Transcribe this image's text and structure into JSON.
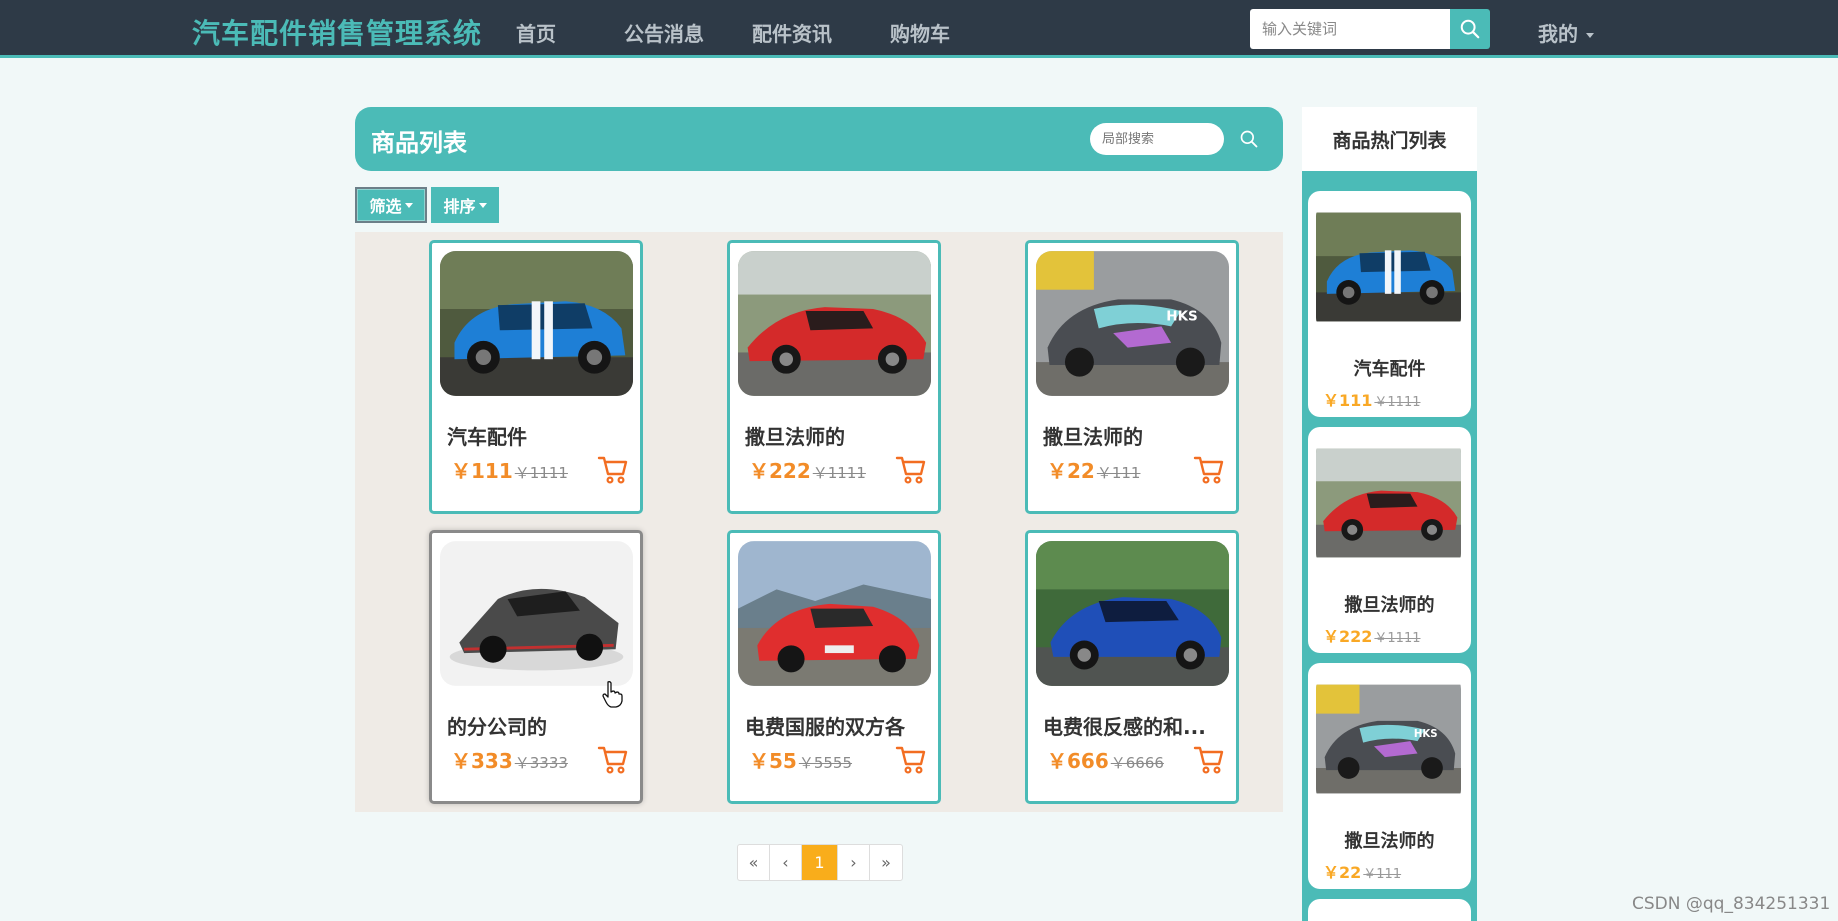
{
  "nav": {
    "brand": "汽车配件销售管理系统",
    "items": [
      "首页",
      "公告消息",
      "配件资讯",
      "购物车"
    ],
    "search_placeholder": "输入关键词",
    "mine": "我的"
  },
  "list": {
    "title": "商品列表",
    "local_search_placeholder": "局部搜索",
    "filter_label": "筛选",
    "sort_label": "排序"
  },
  "products": [
    {
      "name": "汽车配件",
      "price": "￥111",
      "old_price": "￥1111",
      "image": "blue-mustang"
    },
    {
      "name": "撒旦法师的",
      "price": "￥222",
      "old_price": "￥1111",
      "image": "red-ferrari"
    },
    {
      "name": "撒旦法师的",
      "price": "￥22",
      "old_price": "￥111",
      "image": "gray-civic-hks"
    },
    {
      "name": "的分公司的",
      "price": "￥333",
      "old_price": "￥3333",
      "image": "gray-lamborghini"
    },
    {
      "name": "电费国服的双方各",
      "price": "￥55",
      "old_price": "￥5555",
      "image": "red-porsche"
    },
    {
      "name": "电费很反感的和...",
      "price": "￥666",
      "old_price": "￥6666",
      "image": "blue-subaru"
    }
  ],
  "pagination": [
    "«",
    "‹",
    "1",
    "›",
    "»"
  ],
  "hot": {
    "title": "商品热门列表",
    "items": [
      {
        "name": "汽车配件",
        "price": "￥111",
        "old_price": "￥1111",
        "image": "blue-mustang"
      },
      {
        "name": "撒旦法师的",
        "price": "￥222",
        "old_price": "￥1111",
        "image": "red-ferrari"
      },
      {
        "name": "撒旦法师的",
        "price": "￥22",
        "old_price": "￥111",
        "image": "gray-civic-hks"
      }
    ]
  },
  "watermark": "CSDN @qq_834251331",
  "colors": {
    "accent": "#4bbbb7",
    "nav_bg": "#2e3a47",
    "price": "#f28c28",
    "active_page": "#f9ad1b"
  }
}
